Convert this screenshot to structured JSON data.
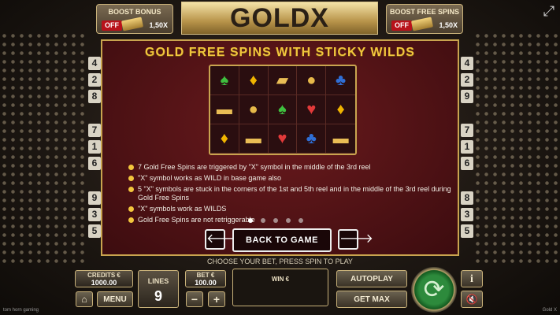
{
  "header": {
    "logo": "GOLDX",
    "boost_bonus": {
      "title": "BOOST BONUS",
      "state": "OFF",
      "multiplier": "1,50X"
    },
    "boost_free_spins": {
      "title": "BOOST FREE SPINS",
      "state": "OFF",
      "multiplier": "1,50X"
    }
  },
  "paylines": {
    "left": [
      "4",
      "2",
      "8",
      "7",
      "1",
      "6",
      "9",
      "3",
      "5"
    ],
    "right": [
      "4",
      "2",
      "9",
      "7",
      "1",
      "6",
      "8",
      "3",
      "5"
    ]
  },
  "info_panel": {
    "title": "GOLD FREE SPINS WITH STICKY WILDS",
    "reel_symbols": [
      [
        "spade-icon",
        "diamond-icon",
        "gold-bars-icon",
        "coins-icon",
        "club-icon"
      ],
      [
        "gold-bar-icon",
        "coins-icon",
        "spade-icon",
        "heart-icon",
        "diamond-icon"
      ],
      [
        "diamond-icon",
        "gold-bar-icon",
        "heart-icon",
        "club-icon",
        "gold-bar-icon"
      ]
    ],
    "bullets": [
      "7 Gold Free Spins are triggered by \"X\" symbol in the middle of the 3rd reel",
      "\"X\" symbol works as WILD in base game also",
      "5 \"X\" symbols are stuck in the corners of the 1st and 5th reel and in the middle of the 3rd reel during Gold Free Spins",
      "\"X\" symbols work as WILDS",
      "Gold Free Spins are not retriggerable"
    ],
    "page_count": 5,
    "active_page": 1,
    "back_label": "BACK TO GAME",
    "prev_symbol": "🡐",
    "next_symbol": "🡒"
  },
  "hint": "CHOOSE YOUR BET, PRESS SPIN TO PLAY",
  "controls": {
    "credits_label": "CREDITS €",
    "credits_value": "1000.00",
    "menu_label": "MENU",
    "lines_label": "LINES",
    "lines_value": "9",
    "bet_label": "BET €",
    "bet_value": "100.00",
    "minus": "−",
    "plus": "+",
    "win_label": "WIN €",
    "autoplay_label": "AUTOPLAY",
    "getmax_label": "GET MAX",
    "info_label": "i",
    "spin_symbol": "⟳"
  },
  "footer": {
    "left": "tom horn gaming",
    "right": "Gold X"
  },
  "colors": {
    "accent": "#f2c63d",
    "panel": "#5a1518",
    "off": "#b8121a",
    "spin": "#2d8a3c"
  }
}
